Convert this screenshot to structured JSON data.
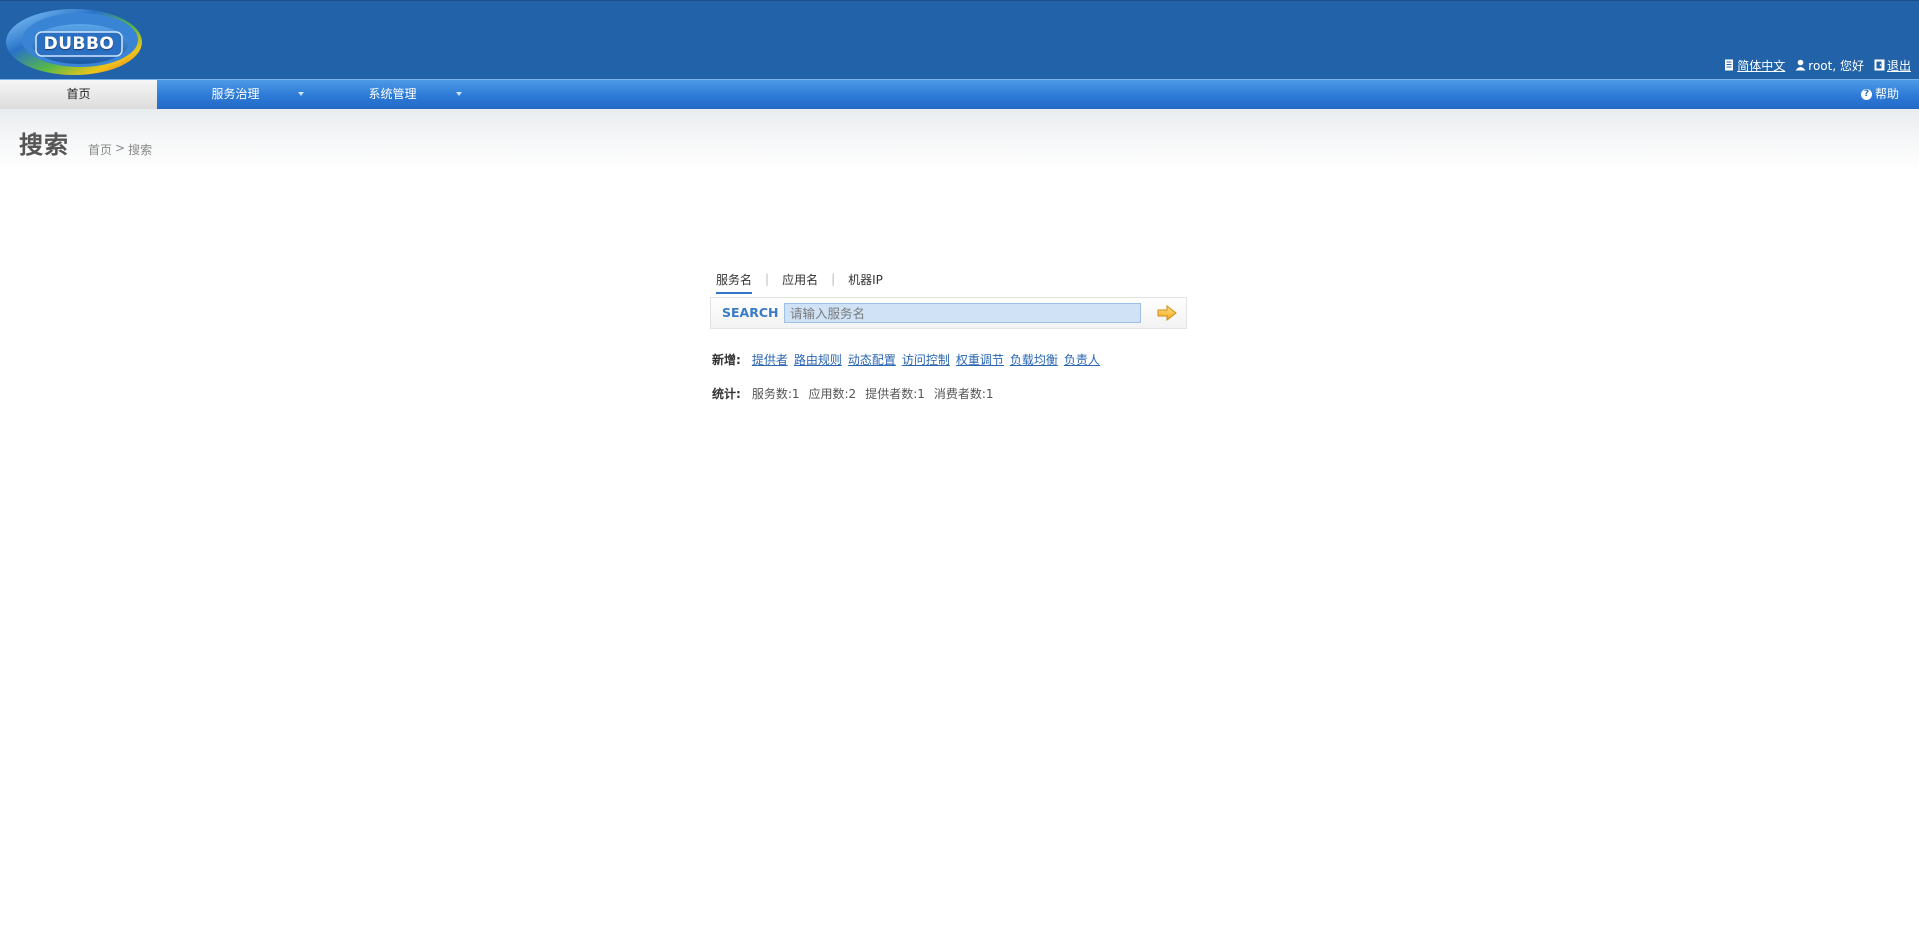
{
  "header": {
    "logo_text": "DUBBO",
    "language_link": "简体中文",
    "user_greeting": "root, 您好",
    "logout_link": "退出"
  },
  "nav": {
    "items": [
      {
        "label": "首页",
        "active": true
      },
      {
        "label": "服务治理",
        "has_dropdown": true
      },
      {
        "label": "系统管理",
        "has_dropdown": true
      }
    ],
    "help": "帮助"
  },
  "page": {
    "title": "搜索",
    "breadcrumb": [
      "首页",
      ">",
      "搜索"
    ]
  },
  "search": {
    "tabs": [
      {
        "label": "服务名",
        "active": true
      },
      {
        "label": "应用名"
      },
      {
        "label": "机器IP"
      }
    ],
    "label": "SEARCH",
    "placeholder": "请输入服务名"
  },
  "create": {
    "label": "新增:",
    "links": [
      "提供者",
      "路由规则",
      "动态配置",
      "访问控制",
      "权重调节",
      "负载均衡",
      "负责人"
    ]
  },
  "stats": {
    "label": "统计:",
    "items": [
      "服务数:1",
      "应用数:2",
      "提供者数:1",
      "消费者数:1"
    ]
  },
  "colors": {
    "header_bg": "#2162a9",
    "nav_bg": "#2c7ad7",
    "link": "#2a66b3",
    "accent": "#3277c5"
  }
}
